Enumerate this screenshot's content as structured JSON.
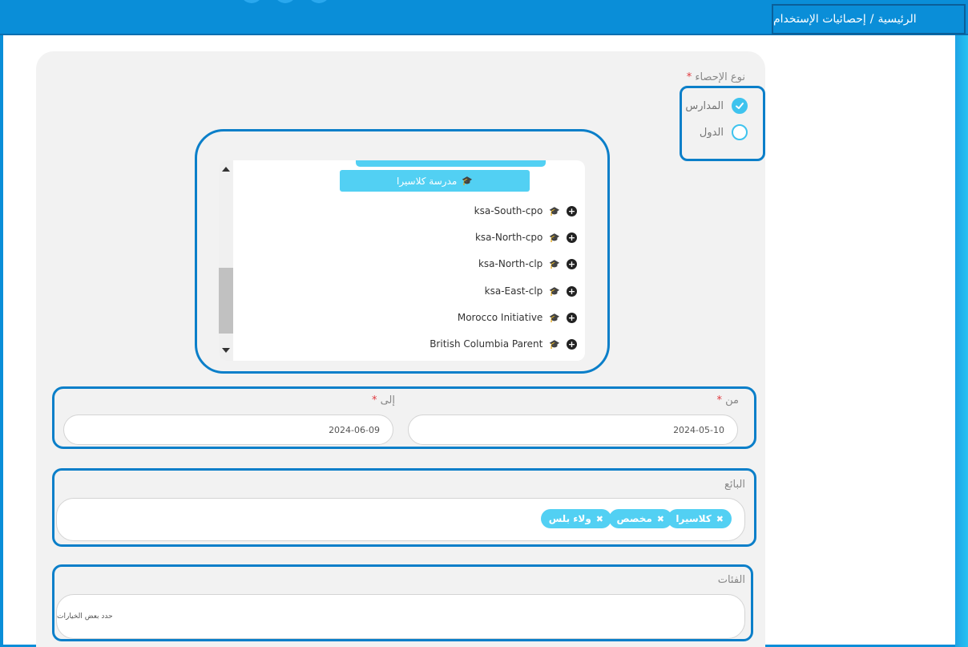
{
  "breadcrumb": {
    "home": "الرئيسية",
    "separator": "/",
    "current": "إحصائيات الإستخدام"
  },
  "stat_type": {
    "label": "نوع الإحصاء",
    "required_mark": "*",
    "options": [
      {
        "label": "المدارس",
        "checked": true
      },
      {
        "label": "الدول",
        "checked": false
      }
    ]
  },
  "tree": {
    "root": "مدرسة كلاسيرا",
    "items": [
      {
        "name": "ksa-South-cpo"
      },
      {
        "name": "ksa-North-cpo"
      },
      {
        "name": "ksa-North-clp"
      },
      {
        "name": "ksa-East-clp"
      },
      {
        "name": "Morocco Initiative"
      },
      {
        "name": "British Columbia Parent"
      }
    ]
  },
  "date_range": {
    "from_label": "من",
    "to_label": "إلى",
    "required_mark": "*",
    "from_value": "2024-05-10",
    "to_value": "2024-06-09"
  },
  "vendor": {
    "label": "البائع",
    "tags": [
      "كلاسيرا",
      "مخصص",
      "ولاء بلس"
    ]
  },
  "categories": {
    "label": "الفئات",
    "placeholder": "حدد بعض الخيارات"
  },
  "colors": {
    "accent": "#52d0f3",
    "header": "#0a8ed8",
    "highlight": "#0b7fc9"
  },
  "icons": {
    "tree_node": "graduation-cap-icon",
    "expand": "plus-circle-icon",
    "tag_remove": "close-icon"
  }
}
